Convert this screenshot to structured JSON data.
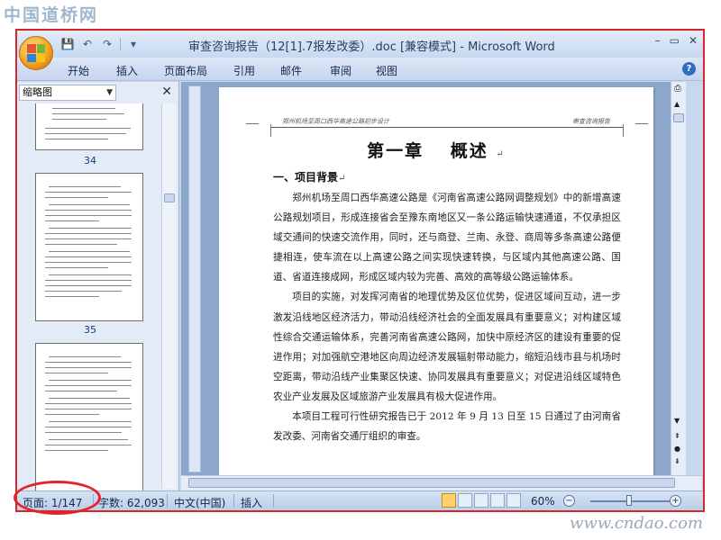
{
  "watermarks": {
    "top": "中国道桥网",
    "bottom": "www.cndao.com"
  },
  "window": {
    "title": "审查咨询报告（12[1].7报发改委）.doc [兼容模式] - Microsoft Word",
    "buttons": {
      "minimize": "–",
      "restore": "▭",
      "close": "✕"
    }
  },
  "qat": {
    "save": "💾",
    "undo": "↶",
    "redo": "↷"
  },
  "menu": {
    "tabs": [
      "开始",
      "插入",
      "页面布局",
      "引用",
      "邮件",
      "审阅",
      "视图"
    ],
    "help": "?"
  },
  "nav": {
    "mode": "缩略图",
    "close": "✕",
    "pages": [
      "34",
      "35"
    ]
  },
  "document": {
    "header_left": "郑州机场至周口西华高速公路初步设计",
    "header_right": "审查咨询报告",
    "chapter_title": "第一章　 概述",
    "para_mark": "↵",
    "section_title": "一、项目背景",
    "paragraphs": [
      "郑州机场至周口西华高速公路是《河南省高速公路网调整规划》中的新增高速公路规划项目，形成连接省会至豫东南地区又一条公路运输快速通道，不仅承担区域交通间的快速交流作用，同时，还与商登、兰南、永登、商周等多条高速公路便捷相连，使车流在以上高速公路之间实现快速转换，与区域内其他高速公路、国道、省道连接成网，形成区域内较为完善、高效的高等级公路运输体系。",
      "项目的实施，对发挥河南省的地理优势及区位优势，促进区域间互动，进一步激发沿线地区经济活力，带动沿线经济社会的全面发展具有重要意义；对构建区域性综合交通运输体系，完善河南省高速公路网，加快中原经济区的建设有重要的促进作用；对加强航空港地区向周边经济发展辐射带动能力，缩短沿线市县与机场时空距离，带动沿线产业集聚区快速、协同发展具有重要意义；对促进沿线区域特色农业产业发展及区域旅游产业发展具有极大促进作用。",
      "本项目工程可行性研究报告已于 2012 年 9 月 13 日至 15 日通过了由河南省发改委、河南省交通厅组织的审查。"
    ]
  },
  "status": {
    "page": "页面: 1/147",
    "words": "字数: 62,093",
    "language": "中文(中国)",
    "mode": "插入",
    "zoom": "60%",
    "zoom_out": "−",
    "zoom_in": "+"
  }
}
